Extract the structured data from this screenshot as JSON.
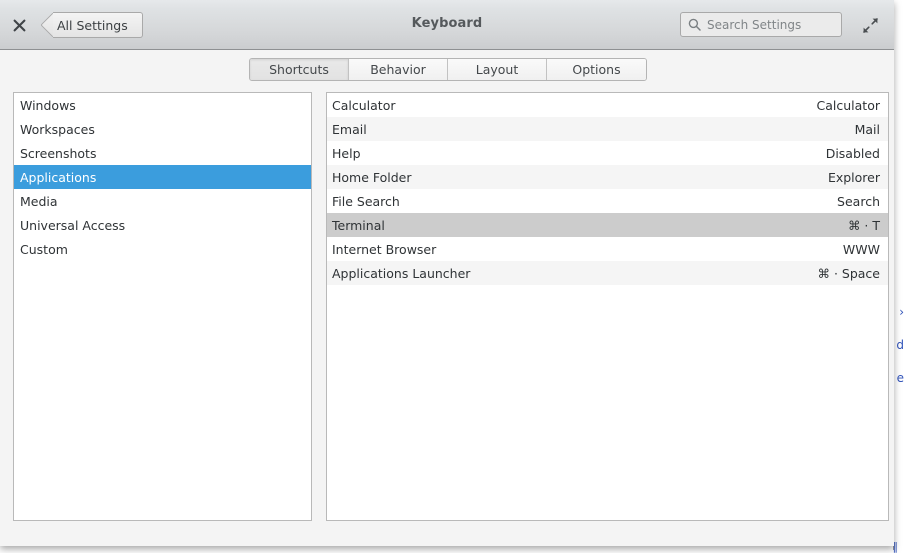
{
  "window": {
    "title": "Keyboard",
    "close_label": "✕",
    "back_label": "All Settings",
    "expand_label": "expand"
  },
  "search": {
    "placeholder": "Search Settings",
    "value": ""
  },
  "tabs": [
    {
      "label": "Shortcuts",
      "active": true
    },
    {
      "label": "Behavior",
      "active": false
    },
    {
      "label": "Layout",
      "active": false
    },
    {
      "label": "Options",
      "active": false
    }
  ],
  "categories": [
    {
      "label": "Windows",
      "selected": false
    },
    {
      "label": "Workspaces",
      "selected": false
    },
    {
      "label": "Screenshots",
      "selected": false
    },
    {
      "label": "Applications",
      "selected": true
    },
    {
      "label": "Media",
      "selected": false
    },
    {
      "label": "Universal Access",
      "selected": false
    },
    {
      "label": "Custom",
      "selected": false
    }
  ],
  "shortcuts": [
    {
      "action": "Calculator",
      "binding": "Calculator",
      "selected": false
    },
    {
      "action": "Email",
      "binding": "Mail",
      "selected": false
    },
    {
      "action": "Help",
      "binding": "Disabled",
      "selected": false
    },
    {
      "action": "Home Folder",
      "binding": "Explorer",
      "selected": false
    },
    {
      "action": "File Search",
      "binding": "Search",
      "selected": false
    },
    {
      "action": "Terminal",
      "binding": "⌘ · T",
      "selected": true
    },
    {
      "action": "Internet Browser",
      "binding": "WWW",
      "selected": false
    },
    {
      "action": "Applications Launcher",
      "binding": "⌘ · Space",
      "selected": false
    }
  ],
  "background_window": {
    "fragments": [
      "›",
      "d",
      "e"
    ],
    "bottom_fragment": "‖"
  },
  "colors": {
    "accent": "#3b9ddd",
    "selection_gray": "#cccccc",
    "zebra": "#f5f5f5",
    "window_bg": "#f4f4f4",
    "header_top": "#e6e9eb",
    "header_bottom": "#cbcdcf",
    "border": "#b9b9b9",
    "bg_window_text": "#3355bb"
  }
}
